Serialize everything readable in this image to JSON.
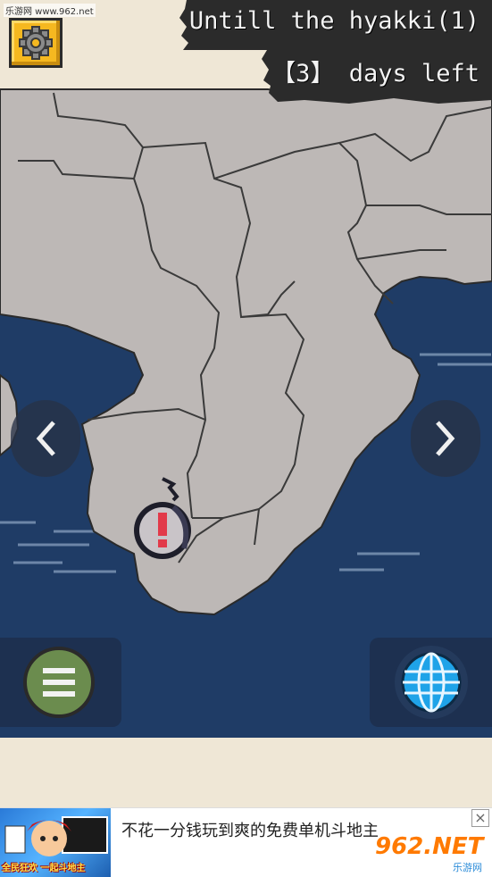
{
  "watermark": "乐游网 www.962.net",
  "header": {
    "title_line1": "Untill the hyakki(1)",
    "title_line2": "【3】 days left"
  },
  "buttons": {
    "settings_icon": "gear-icon",
    "prev_icon": "chevron-left-icon",
    "next_icon": "chevron-right-icon",
    "menu_icon": "hamburger-menu-icon",
    "world_icon": "globe-icon"
  },
  "map": {
    "event_marker_symbol": "!"
  },
  "ad": {
    "text": "不花一分钱玩到爽的免费单机斗地主",
    "thumb_label": "全民狂欢 一起斗地主",
    "logo_main": "962.NET",
    "logo_sub": "乐游网",
    "close_symbol": "×"
  },
  "colors": {
    "sea": "#1f3c66",
    "land": "#bdb8b6",
    "parchment": "#efe7d6",
    "banner": "#2b2b2b",
    "settings": "#f5b820",
    "menu": "#6b8c4e",
    "globe": "#1fa3e8",
    "marker": "#e23a4a"
  }
}
